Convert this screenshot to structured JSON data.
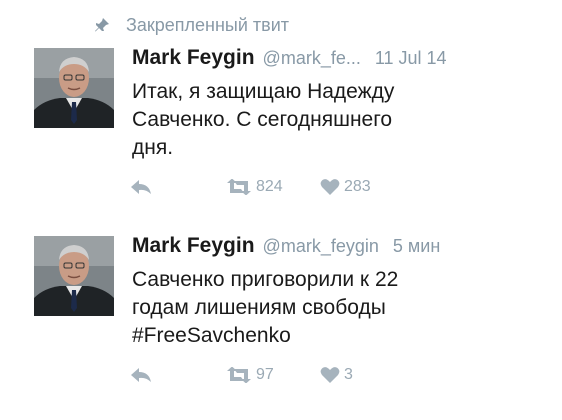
{
  "pinned_label": "Закрепленный твит",
  "icons": {
    "pin": "pin-icon",
    "reply": "reply-icon",
    "retweet": "retweet-icon",
    "like": "heart-icon"
  },
  "colors": {
    "muted": "#8899a6",
    "action": "#a6b3bd",
    "text": "#1a1a1a"
  },
  "tweets": [
    {
      "name": "Mark Feygin",
      "handle": "@mark_fe...",
      "time": "11 Jul 14",
      "text_lines": [
        "Итак, я защищаю Надежду",
        "Савченко. С сегодняшнего",
        "дня."
      ],
      "retweets": "824",
      "likes": "283"
    },
    {
      "name": "Mark Feygin",
      "handle": "@mark_feygin",
      "time": "5 мин",
      "text_lines": [
        "Савченко приговорили к 22",
        "годам лишениям свободы",
        "#FreeSavchenko"
      ],
      "retweets": "97",
      "likes": "3"
    }
  ]
}
